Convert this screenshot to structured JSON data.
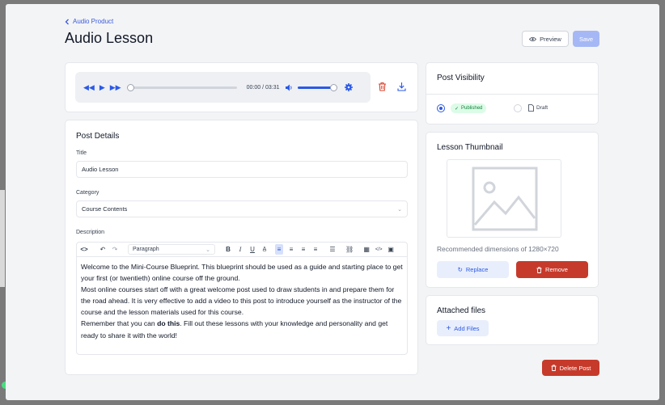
{
  "header": {
    "back_label": "Audio Product",
    "title": "Audio Lesson",
    "preview_label": "Preview",
    "save_label": "Save"
  },
  "player": {
    "current_time": "00:00",
    "separator": "/",
    "duration": "03:31",
    "progress": 0,
    "volume": 1
  },
  "post_details": {
    "heading": "Post Details",
    "title_label": "Title",
    "title_value": "Audio Lesson",
    "category_label": "Category",
    "category_value": "Course Contents",
    "description_label": "Description",
    "format_select": "Paragraph",
    "description_lines": {
      "p1": "Welcome to the Mini-Course Blueprint. This blueprint should be used as a guide and starting place to get your first (or twentieth) online course off the ground.",
      "p2": "Most online courses start off with a great welcome post used to draw students in and prepare them for the road ahead. It is very effective to add a video to this post to introduce yourself as the instructor of the course and the lesson materials used for this course.",
      "p3_pre": "Remember that you can ",
      "p3_bold": "do this",
      "p3_post": ". Fill out these lessons with your knowledge and personality and get ready to share it with the world!"
    }
  },
  "visibility": {
    "heading": "Post Visibility",
    "published_label": "Published",
    "draft_label": "Draft",
    "selected": "Published"
  },
  "thumbnail": {
    "heading": "Lesson Thumbnail",
    "dimensions_text": "Recommended dimensions of 1280×720",
    "replace_label": "Replace",
    "remove_label": "Remove"
  },
  "files": {
    "heading": "Attached files",
    "add_label": "Add Files"
  },
  "footer": {
    "delete_label": "Delete Post"
  },
  "colors": {
    "accent": "#2b59e6",
    "danger": "#c63a2b",
    "success_bg": "#dcfce7",
    "success_fg": "#15803d"
  }
}
